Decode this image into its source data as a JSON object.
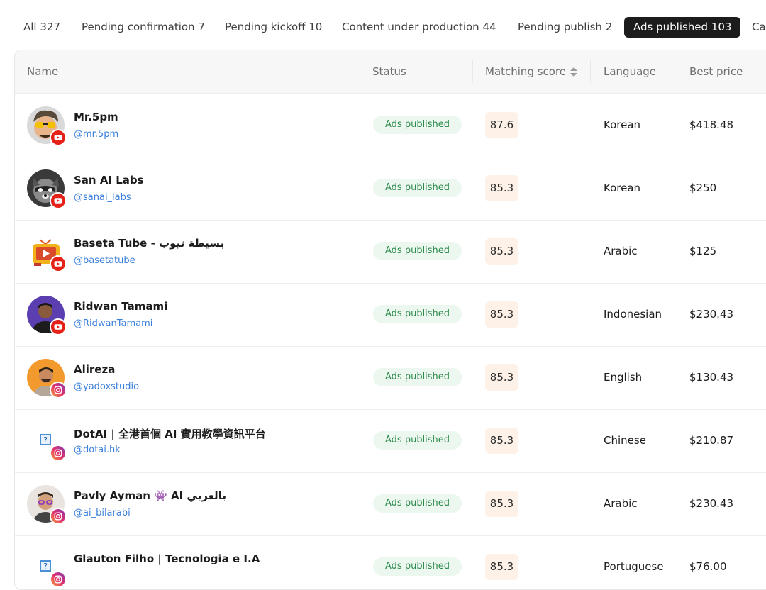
{
  "tabs": [
    {
      "label": "All 327"
    },
    {
      "label": "Pending confirmation 7"
    },
    {
      "label": "Pending kickoff 10"
    },
    {
      "label": "Content under production 44"
    },
    {
      "label": "Pending publish 2"
    },
    {
      "label": "Ads published 103",
      "active": true
    },
    {
      "label": "Ca"
    }
  ],
  "columns": {
    "name": "Name",
    "status": "Status",
    "score": "Matching score",
    "language": "Language",
    "price": "Best price"
  },
  "rows": [
    {
      "name": "Mr.5pm",
      "handle": "@mr.5pm",
      "platform": "youtube",
      "status": "Ads published",
      "score": "87.6",
      "language": "Korean",
      "price": "$418.48",
      "avatar": "cartoon-man"
    },
    {
      "name": "San AI Labs",
      "handle": "@sanai_labs",
      "platform": "youtube",
      "status": "Ads published",
      "score": "85.3",
      "language": "Korean",
      "price": "$250",
      "avatar": "raccoon"
    },
    {
      "name": "Baseta Tube - بسيطة تيوب",
      "handle": "@basetatube",
      "platform": "youtube",
      "status": "Ads published",
      "score": "85.3",
      "language": "Arabic",
      "price": "$125",
      "avatar": "tv-logo"
    },
    {
      "name": "Ridwan Tamami",
      "handle": "@RidwanTamami",
      "platform": "youtube",
      "status": "Ads published",
      "score": "85.3",
      "language": "Indonesian",
      "price": "$230.43",
      "avatar": "man-purple"
    },
    {
      "name": "Alireza",
      "handle": "@yadoxstudio",
      "platform": "instagram",
      "status": "Ads published",
      "score": "85.3",
      "language": "English",
      "price": "$130.43",
      "avatar": "man-orange"
    },
    {
      "name": "DotAI | 全港首個 AI 實用教學資訊平台",
      "handle": "@dotai.hk",
      "platform": "instagram",
      "status": "Ads published",
      "score": "85.3",
      "language": "Chinese",
      "price": "$210.87",
      "avatar": "placeholder"
    },
    {
      "name": "Pavly Ayman 👾 AI بالعربي",
      "handle": "@ai_bilarabi",
      "platform": "instagram",
      "status": "Ads published",
      "score": "85.3",
      "language": "Arabic",
      "price": "$230.43",
      "avatar": "man-glasses"
    },
    {
      "name": "Glauton Filho | Tecnologia e I.A",
      "handle": "",
      "platform": "instagram",
      "status": "Ads published",
      "score": "85.3",
      "language": "Portuguese",
      "price": "$76.00",
      "avatar": "placeholder"
    }
  ]
}
